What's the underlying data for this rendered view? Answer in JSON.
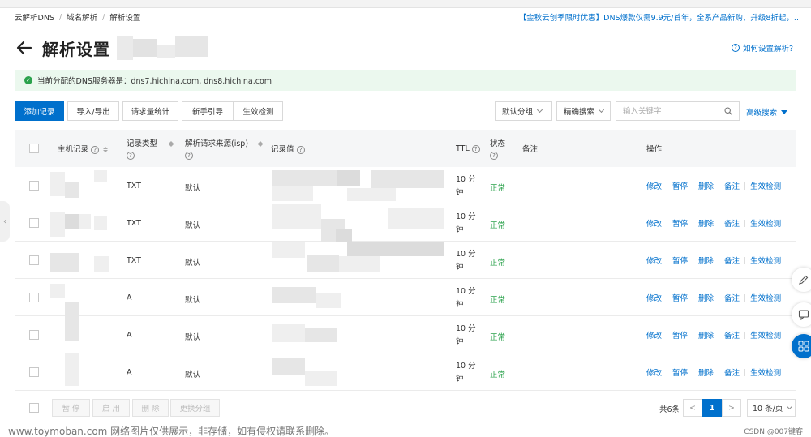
{
  "breadcrumb": [
    "云解析DNS",
    "域名解析",
    "解析设置"
  ],
  "breadcrumb_sep": "/",
  "promo": "【金秋云创季限时优惠】DNS爆款仅需9.9元/首年，全系产品新购、升级8折起，...",
  "page_title": "解析设置",
  "help_link": "如何设置解析?",
  "notice": "当前分配的DNS服务器是：dns7.hichina.com, dns8.hichina.com",
  "toolbar": {
    "add": "添加记录",
    "import_export": "导入/导出",
    "stats": "请求量统计",
    "guide": "新手引导",
    "check": "生效检测",
    "group_select": "默认分组",
    "precise_search": "精确搜索",
    "keyword_placeholder": "输入关键字",
    "advanced": "高级搜索"
  },
  "columns": {
    "host": "主机记录",
    "type_l1": "记录类型",
    "isp_l1": "解析请求来源(isp)",
    "value": "记录值",
    "ttl": "TTL",
    "status_l1": "状态",
    "remark": "备注",
    "ops": "操作"
  },
  "help_mark": "?",
  "rows": [
    {
      "type": "TXT",
      "isp": "默认",
      "ttl_l1": "10 分",
      "ttl_l2": "钟",
      "status": "正常"
    },
    {
      "type": "TXT",
      "isp": "默认",
      "ttl_l1": "10 分",
      "ttl_l2": "钟",
      "status": "正常"
    },
    {
      "type": "TXT",
      "isp": "默认",
      "ttl_l1": "10 分",
      "ttl_l2": "钟",
      "status": "正常"
    },
    {
      "type": "A",
      "isp": "默认",
      "ttl_l1": "10 分",
      "ttl_l2": "钟",
      "status": "正常"
    },
    {
      "type": "A",
      "isp": "默认",
      "ttl_l1": "10 分",
      "ttl_l2": "钟",
      "status": "正常"
    },
    {
      "type": "A",
      "isp": "默认",
      "ttl_l1": "10 分",
      "ttl_l2": "钟",
      "status": "正常"
    }
  ],
  "row_ops": [
    "修改",
    "暂停",
    "删除",
    "备注",
    "生效检测"
  ],
  "footer": {
    "pause": "暂 停",
    "enable": "启 用",
    "delete": "删 除",
    "change_group": "更换分组",
    "total": "共6条",
    "prev": "<",
    "page": "1",
    "next": ">",
    "per_page": "10 条/页"
  },
  "watermark": "www.toymoban.com 网络图片仅供展示，非存储，如有侵权请联系删除。",
  "csdn": "CSDN @007键客",
  "colors": {
    "primary": "#0070cc",
    "success": "#2ba24c",
    "notice_bg": "#ebf8ee"
  }
}
